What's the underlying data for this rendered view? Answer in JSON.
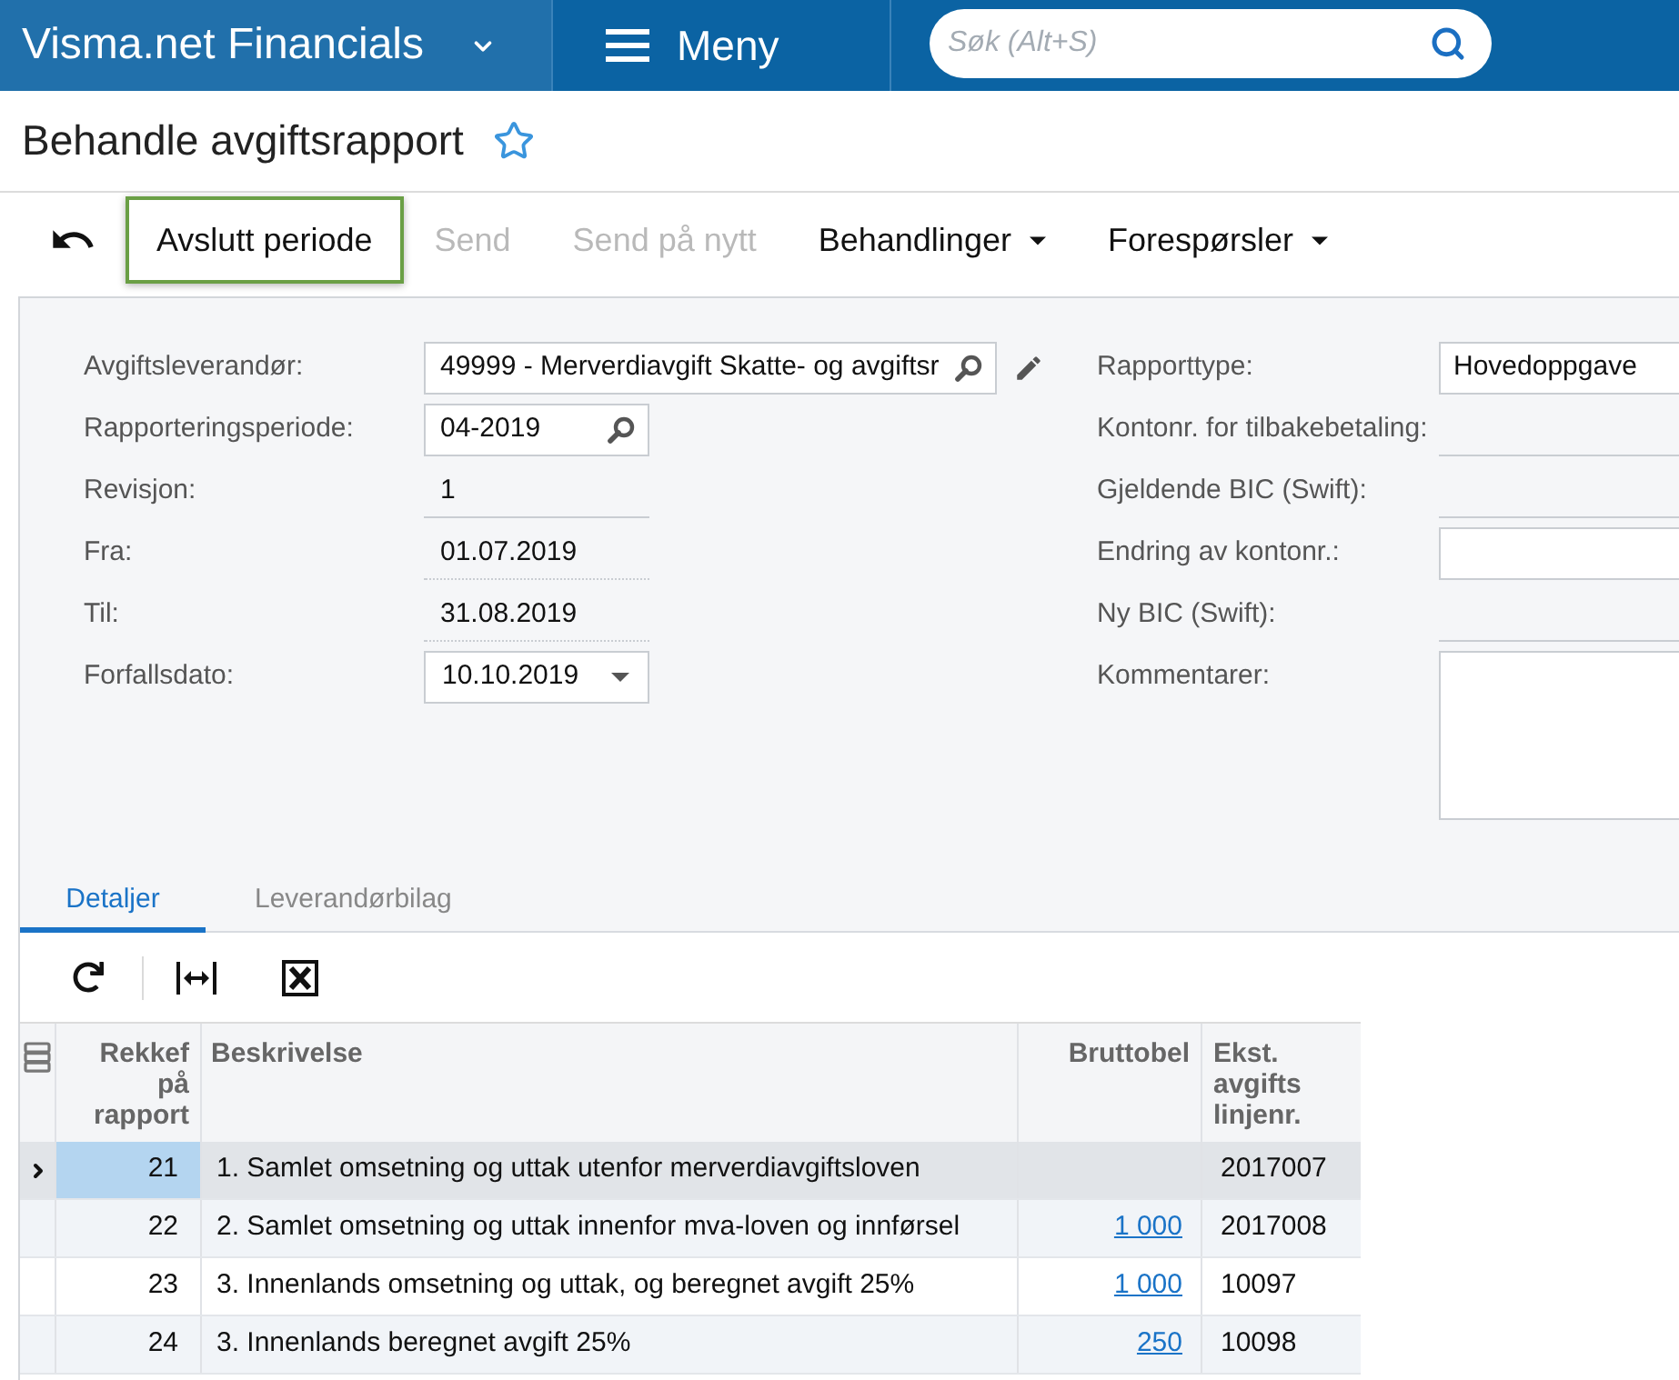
{
  "header": {
    "app_title": "Visma.net Financials",
    "menu_label": "Meny",
    "search": {
      "placeholder": "Søk (Alt+S)"
    }
  },
  "page": {
    "title": "Behandle avgiftsrapport",
    "favorite": false
  },
  "toolbar": {
    "buttons": [
      {
        "label": "Avslutt periode",
        "disabled": false,
        "focused": true,
        "dropdown": false
      },
      {
        "label": "Send",
        "disabled": true,
        "focused": false,
        "dropdown": false
      },
      {
        "label": "Send på nytt",
        "disabled": true,
        "focused": false,
        "dropdown": false
      },
      {
        "label": "Behandlinger",
        "disabled": false,
        "focused": false,
        "dropdown": true
      },
      {
        "label": "Forespørsler",
        "disabled": false,
        "focused": false,
        "dropdown": true
      }
    ]
  },
  "form": {
    "left": [
      {
        "label": "Avgiftsleverandør:",
        "kind": "lookup",
        "value": "49999 - Merverdiavgift Skatte- og avgiftsr",
        "edit_button": true
      },
      {
        "label": "Rapporteringsperiode:",
        "kind": "lookup",
        "value": "04-2019",
        "edit_button": false
      },
      {
        "label": "Revisjon:",
        "kind": "readonly",
        "value": "1"
      },
      {
        "label": "Fra:",
        "kind": "readonly_date",
        "value": "01.07.2019"
      },
      {
        "label": "Til:",
        "kind": "readonly_date",
        "value": "31.08.2019"
      },
      {
        "label": "Forfallsdato:",
        "kind": "date",
        "value": "10.10.2019"
      }
    ],
    "right": [
      {
        "label": "Rapporttype:",
        "kind": "select",
        "value": "Hovedoppgave"
      },
      {
        "label": "Kontonr. for tilbakebetaling:",
        "kind": "readonly"
      },
      {
        "label": "Gjeldende BIC (Swift):",
        "kind": "readonly"
      },
      {
        "label": "Endring av kontonr.:",
        "kind": "input"
      },
      {
        "label": "Ny BIC (Swift):",
        "kind": "readonly"
      },
      {
        "label": "Kommentarer:",
        "kind": "textarea"
      }
    ]
  },
  "tabs": [
    {
      "label": "Detaljer",
      "selected": true
    },
    {
      "label": "Leverandørbilag",
      "selected": false
    }
  ],
  "grid": {
    "columns": [
      "Rekkef på rapport",
      "Beskrivelse",
      "Bruttobel",
      "Ekst. avgifts linjenr."
    ],
    "rows": [
      {
        "order": "21",
        "description": "1. Samlet omsetning og uttak utenfor merverdiavgiftsloven",
        "line_no": "2017007",
        "selected": true
      },
      {
        "order": "22",
        "description": "2. Samlet omsetning og uttak innenfor mva-loven og innførsel",
        "gross": "1 000",
        "line_no": "2017008",
        "selected": false
      },
      {
        "order": "23",
        "description": "3. Innenlands omsetning og uttak, og beregnet avgift 25%",
        "gross": "1 000",
        "line_no": "10097",
        "selected": false
      },
      {
        "order": "24",
        "description": "3. Innenlands beregnet avgift 25%",
        "gross": "250",
        "line_no": "10098",
        "selected": false
      }
    ]
  }
}
